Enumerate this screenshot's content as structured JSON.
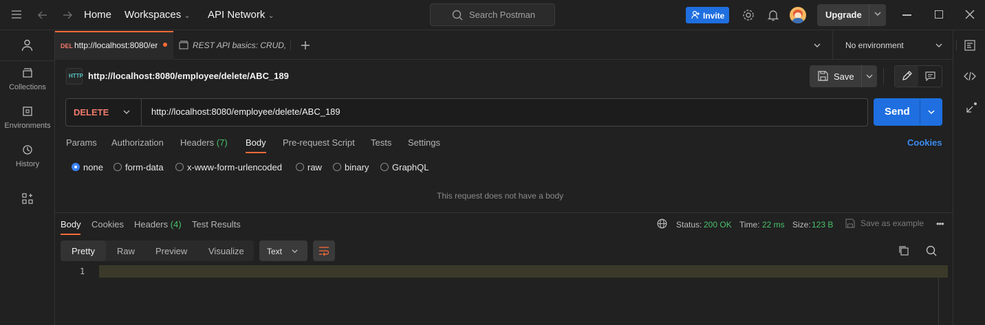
{
  "topbar": {
    "home": "Home",
    "workspaces": "Workspaces",
    "api_network": "API Network",
    "search_placeholder": "Search Postman",
    "invite": "Invite",
    "upgrade": "Upgrade"
  },
  "sidebar": {
    "items": [
      {
        "label": "Collections",
        "icon": "collections-icon"
      },
      {
        "label": "Environments",
        "icon": "environments-icon"
      },
      {
        "label": "History",
        "icon": "history-icon"
      }
    ]
  },
  "tabs": {
    "active": {
      "method": "DEL",
      "title": "http://localhost:8080/er"
    },
    "second": {
      "title": "REST API basics: CRUD,"
    },
    "environment": "No environment"
  },
  "request": {
    "badge": "HTTP",
    "title": "http://localhost:8080/employee/delete/ABC_189",
    "save": "Save",
    "method": "DELETE",
    "url": "http://localhost:8080/employee/delete/ABC_189",
    "send": "Send",
    "tabs": [
      "Params",
      "Authorization",
      "Headers",
      "Body",
      "Pre-request Script",
      "Tests",
      "Settings"
    ],
    "headers_count": "(7)",
    "cookies": "Cookies",
    "body_types": [
      "none",
      "form-data",
      "x-www-form-urlencoded",
      "raw",
      "binary",
      "GraphQL"
    ],
    "no_body_msg": "This request does not have a body"
  },
  "response": {
    "tabs": [
      "Body",
      "Cookies",
      "Headers",
      "Test Results"
    ],
    "headers_count": "(4)",
    "status_label": "Status:",
    "status_value": "200 OK",
    "time_label": "Time:",
    "time_value": "22 ms",
    "size_label": "Size:",
    "size_value": "123 B",
    "save_example": "Save as example",
    "view_tabs": [
      "Pretty",
      "Raw",
      "Preview",
      "Visualize"
    ],
    "format": "Text",
    "line_number": "1"
  },
  "colors": {
    "accent": "#ff6c37",
    "primary": "#1f6fe0",
    "method_delete": "#f27b6c",
    "success": "#49c26b"
  }
}
